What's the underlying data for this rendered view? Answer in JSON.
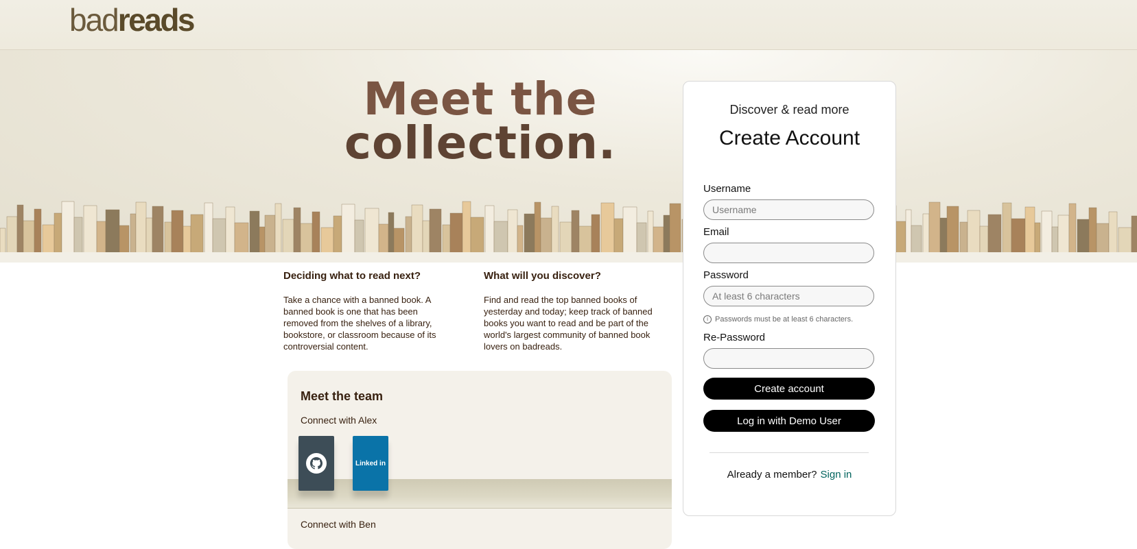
{
  "header": {
    "logo_bad": "bad",
    "logo_reads": "reads"
  },
  "hero": {
    "title_line1": "Meet the",
    "title_line2": "collection."
  },
  "info": [
    {
      "heading": "Deciding what to read next?",
      "text": "Take a chance with a banned book. A banned book is one that has been removed from the shelves of a library, bookstore, or classroom because of its controversial content."
    },
    {
      "heading": "What will you discover?",
      "text": "Find and read the top banned books of yesterday and today; keep track of banned books you want to read and be part of the world's largest community of banned book lovers on badreads."
    }
  ],
  "team": {
    "title": "Meet the team",
    "connect_alex": "Connect with Alex",
    "connect_ben": "Connect with Ben",
    "linkedin_label": "Linked in"
  },
  "signup": {
    "subtitle": "Discover & read more",
    "title": "Create Account",
    "username_label": "Username",
    "username_placeholder": "Username",
    "email_label": "Email",
    "password_label": "Password",
    "password_placeholder": "At least 6 characters",
    "password_hint": "Passwords must be at least 6 characters.",
    "repassword_label": "Re-Password",
    "create_button": "Create account",
    "demo_button": "Log in with Demo User",
    "member_text": "Already a member?",
    "signin_link": "Sign in"
  },
  "colors": {
    "brand_brown": "#382110",
    "link_teal": "#00635d",
    "button_black": "#000000"
  }
}
